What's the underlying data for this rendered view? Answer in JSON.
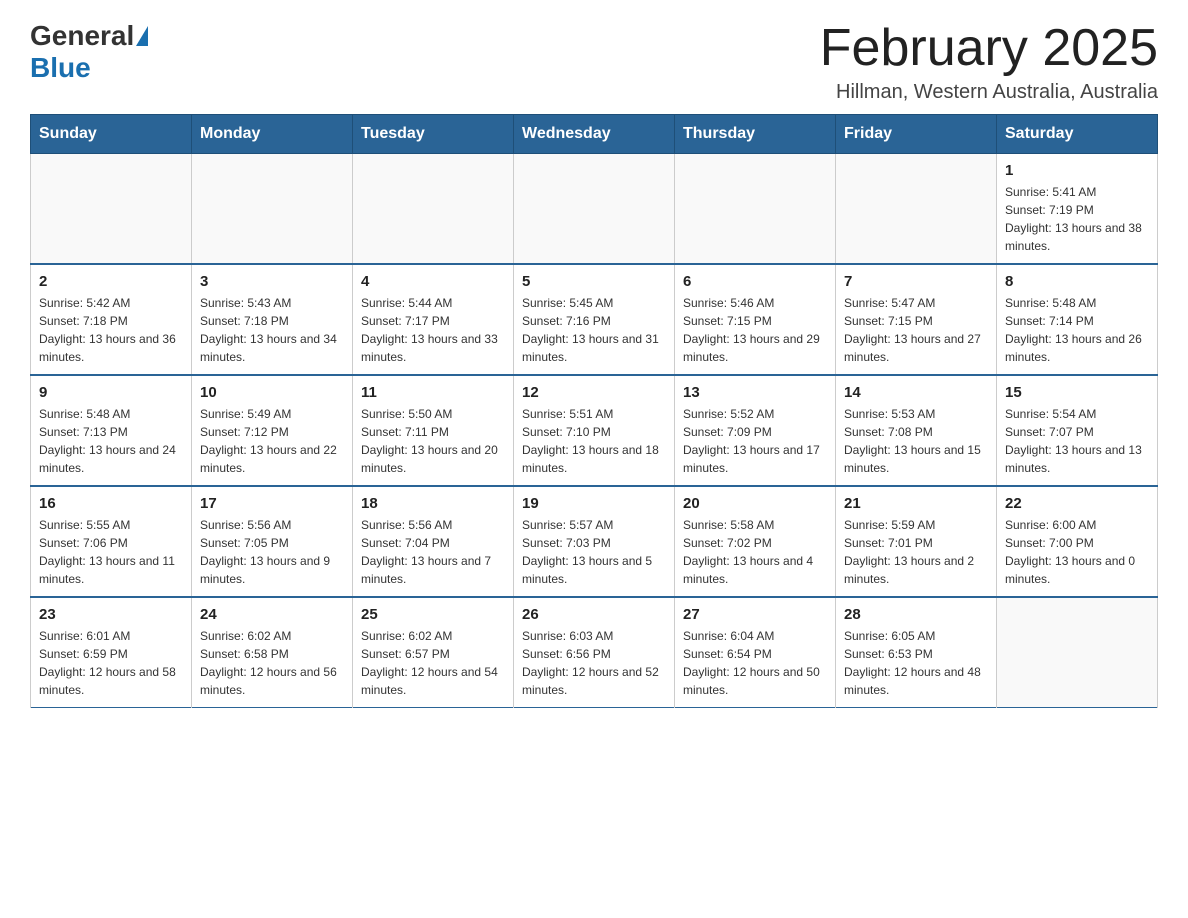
{
  "header": {
    "logo_general": "General",
    "logo_blue": "Blue",
    "month_title": "February 2025",
    "location": "Hillman, Western Australia, Australia"
  },
  "weekdays": [
    "Sunday",
    "Monday",
    "Tuesday",
    "Wednesday",
    "Thursday",
    "Friday",
    "Saturday"
  ],
  "weeks": [
    [
      {
        "day": "",
        "info": ""
      },
      {
        "day": "",
        "info": ""
      },
      {
        "day": "",
        "info": ""
      },
      {
        "day": "",
        "info": ""
      },
      {
        "day": "",
        "info": ""
      },
      {
        "day": "",
        "info": ""
      },
      {
        "day": "1",
        "info": "Sunrise: 5:41 AM\nSunset: 7:19 PM\nDaylight: 13 hours and 38 minutes."
      }
    ],
    [
      {
        "day": "2",
        "info": "Sunrise: 5:42 AM\nSunset: 7:18 PM\nDaylight: 13 hours and 36 minutes."
      },
      {
        "day": "3",
        "info": "Sunrise: 5:43 AM\nSunset: 7:18 PM\nDaylight: 13 hours and 34 minutes."
      },
      {
        "day": "4",
        "info": "Sunrise: 5:44 AM\nSunset: 7:17 PM\nDaylight: 13 hours and 33 minutes."
      },
      {
        "day": "5",
        "info": "Sunrise: 5:45 AM\nSunset: 7:16 PM\nDaylight: 13 hours and 31 minutes."
      },
      {
        "day": "6",
        "info": "Sunrise: 5:46 AM\nSunset: 7:15 PM\nDaylight: 13 hours and 29 minutes."
      },
      {
        "day": "7",
        "info": "Sunrise: 5:47 AM\nSunset: 7:15 PM\nDaylight: 13 hours and 27 minutes."
      },
      {
        "day": "8",
        "info": "Sunrise: 5:48 AM\nSunset: 7:14 PM\nDaylight: 13 hours and 26 minutes."
      }
    ],
    [
      {
        "day": "9",
        "info": "Sunrise: 5:48 AM\nSunset: 7:13 PM\nDaylight: 13 hours and 24 minutes."
      },
      {
        "day": "10",
        "info": "Sunrise: 5:49 AM\nSunset: 7:12 PM\nDaylight: 13 hours and 22 minutes."
      },
      {
        "day": "11",
        "info": "Sunrise: 5:50 AM\nSunset: 7:11 PM\nDaylight: 13 hours and 20 minutes."
      },
      {
        "day": "12",
        "info": "Sunrise: 5:51 AM\nSunset: 7:10 PM\nDaylight: 13 hours and 18 minutes."
      },
      {
        "day": "13",
        "info": "Sunrise: 5:52 AM\nSunset: 7:09 PM\nDaylight: 13 hours and 17 minutes."
      },
      {
        "day": "14",
        "info": "Sunrise: 5:53 AM\nSunset: 7:08 PM\nDaylight: 13 hours and 15 minutes."
      },
      {
        "day": "15",
        "info": "Sunrise: 5:54 AM\nSunset: 7:07 PM\nDaylight: 13 hours and 13 minutes."
      }
    ],
    [
      {
        "day": "16",
        "info": "Sunrise: 5:55 AM\nSunset: 7:06 PM\nDaylight: 13 hours and 11 minutes."
      },
      {
        "day": "17",
        "info": "Sunrise: 5:56 AM\nSunset: 7:05 PM\nDaylight: 13 hours and 9 minutes."
      },
      {
        "day": "18",
        "info": "Sunrise: 5:56 AM\nSunset: 7:04 PM\nDaylight: 13 hours and 7 minutes."
      },
      {
        "day": "19",
        "info": "Sunrise: 5:57 AM\nSunset: 7:03 PM\nDaylight: 13 hours and 5 minutes."
      },
      {
        "day": "20",
        "info": "Sunrise: 5:58 AM\nSunset: 7:02 PM\nDaylight: 13 hours and 4 minutes."
      },
      {
        "day": "21",
        "info": "Sunrise: 5:59 AM\nSunset: 7:01 PM\nDaylight: 13 hours and 2 minutes."
      },
      {
        "day": "22",
        "info": "Sunrise: 6:00 AM\nSunset: 7:00 PM\nDaylight: 13 hours and 0 minutes."
      }
    ],
    [
      {
        "day": "23",
        "info": "Sunrise: 6:01 AM\nSunset: 6:59 PM\nDaylight: 12 hours and 58 minutes."
      },
      {
        "day": "24",
        "info": "Sunrise: 6:02 AM\nSunset: 6:58 PM\nDaylight: 12 hours and 56 minutes."
      },
      {
        "day": "25",
        "info": "Sunrise: 6:02 AM\nSunset: 6:57 PM\nDaylight: 12 hours and 54 minutes."
      },
      {
        "day": "26",
        "info": "Sunrise: 6:03 AM\nSunset: 6:56 PM\nDaylight: 12 hours and 52 minutes."
      },
      {
        "day": "27",
        "info": "Sunrise: 6:04 AM\nSunset: 6:54 PM\nDaylight: 12 hours and 50 minutes."
      },
      {
        "day": "28",
        "info": "Sunrise: 6:05 AM\nSunset: 6:53 PM\nDaylight: 12 hours and 48 minutes."
      },
      {
        "day": "",
        "info": ""
      }
    ]
  ]
}
